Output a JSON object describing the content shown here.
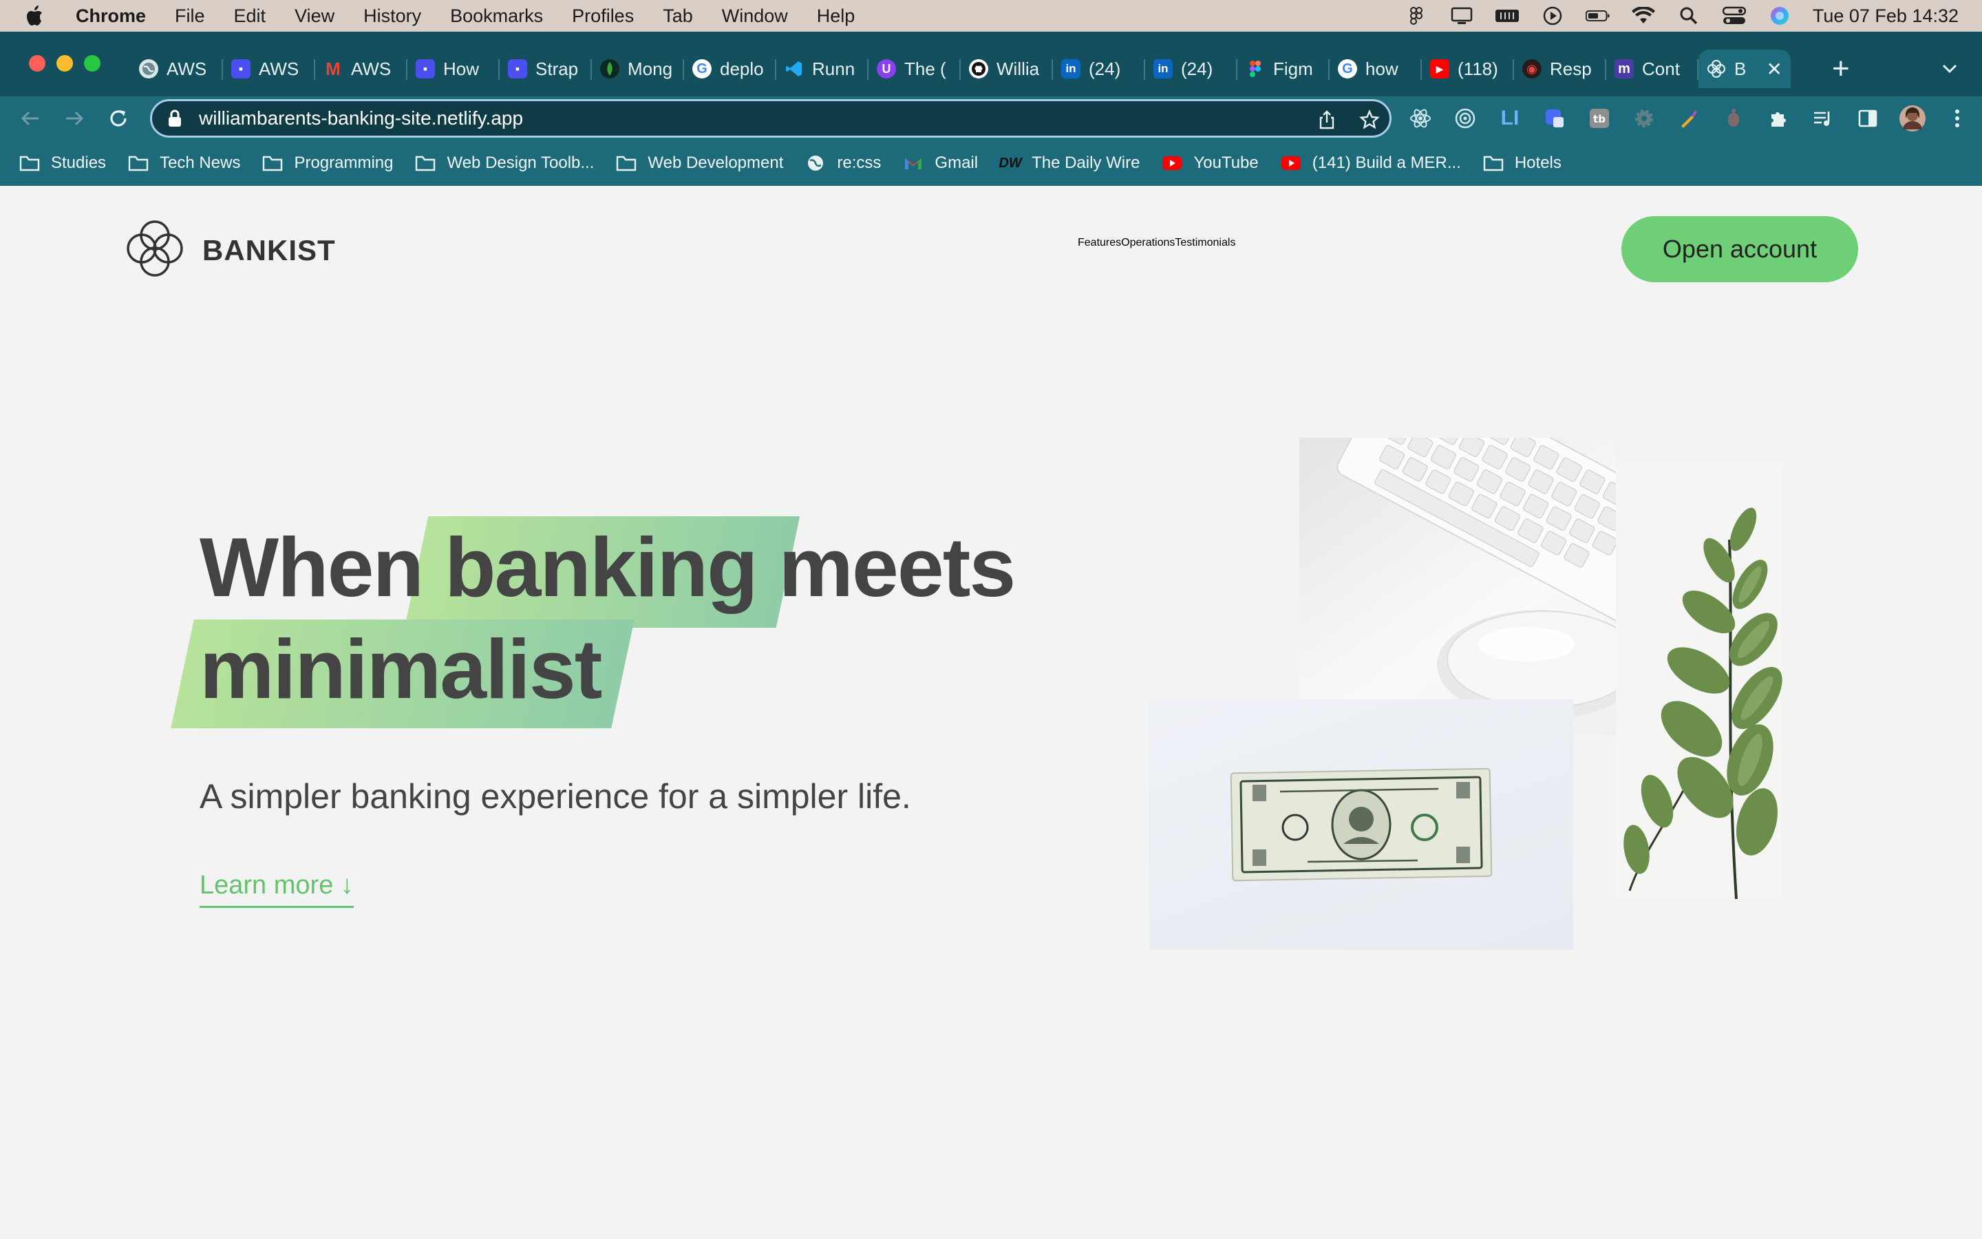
{
  "menubar": {
    "app": "Chrome",
    "items": [
      "File",
      "Edit",
      "View",
      "History",
      "Bookmarks",
      "Profiles",
      "Tab",
      "Window",
      "Help"
    ],
    "clock": "Tue 07 Feb  14:32"
  },
  "tabs": [
    {
      "label": "AWS",
      "icon": "globe-icon"
    },
    {
      "label": "AWS",
      "icon": "app-icon"
    },
    {
      "label": "AWS",
      "icon": "gmail-icon"
    },
    {
      "label": "How",
      "icon": "app-icon"
    },
    {
      "label": "Strap",
      "icon": "app-icon"
    },
    {
      "label": "Mong",
      "icon": "leaf-icon"
    },
    {
      "label": "deplo",
      "icon": "google-icon"
    },
    {
      "label": "Runn",
      "icon": "vscode-icon"
    },
    {
      "label": "The (",
      "icon": "purple-icon"
    },
    {
      "label": "Willia",
      "icon": "github-icon"
    },
    {
      "label": "(24)",
      "icon": "linkedin-icon"
    },
    {
      "label": "(24)",
      "icon": "linkedin-icon"
    },
    {
      "label": "Figm",
      "icon": "figma-icon"
    },
    {
      "label": "how",
      "icon": "google-icon"
    },
    {
      "label": "(118)",
      "icon": "youtube-icon"
    },
    {
      "label": "Resp",
      "icon": "ninja-icon"
    },
    {
      "label": "Cont",
      "icon": "m-icon"
    },
    {
      "label": "B",
      "icon": "bankist-icon",
      "active": true
    }
  ],
  "address": {
    "url": "williambarents-banking-site.netlify.app"
  },
  "bookmarks": [
    {
      "label": "Studies",
      "icon": "folder-icon"
    },
    {
      "label": "Tech News",
      "icon": "folder-icon"
    },
    {
      "label": "Programming",
      "icon": "folder-icon"
    },
    {
      "label": "Web Design Toolb...",
      "icon": "folder-icon"
    },
    {
      "label": "Web Development",
      "icon": "folder-icon"
    },
    {
      "label": "re:css",
      "icon": "globe-icon"
    },
    {
      "label": "Gmail",
      "icon": "gmail-icon"
    },
    {
      "label": "The Daily Wire",
      "icon": "dw-icon"
    },
    {
      "label": "YouTube",
      "icon": "youtube-icon"
    },
    {
      "label": "(141) Build a MER...",
      "icon": "youtube-icon"
    },
    {
      "label": "Hotels",
      "icon": "folder-icon"
    }
  ],
  "site": {
    "brand": "BANKIST",
    "nav": [
      "Features",
      "Operations",
      "Testimonials"
    ],
    "cta": "Open account",
    "hero": {
      "line1_a": "When",
      "line1_b": "banking",
      "line1_c": "meets",
      "line2": "minimalist",
      "subtitle": "A simpler banking experience for a simpler life.",
      "learn_more": "Learn more ↓"
    }
  },
  "colors": {
    "accent": "#6fcf77",
    "tabstrip": "#134f5c",
    "toolbar": "#1d6b7a"
  }
}
